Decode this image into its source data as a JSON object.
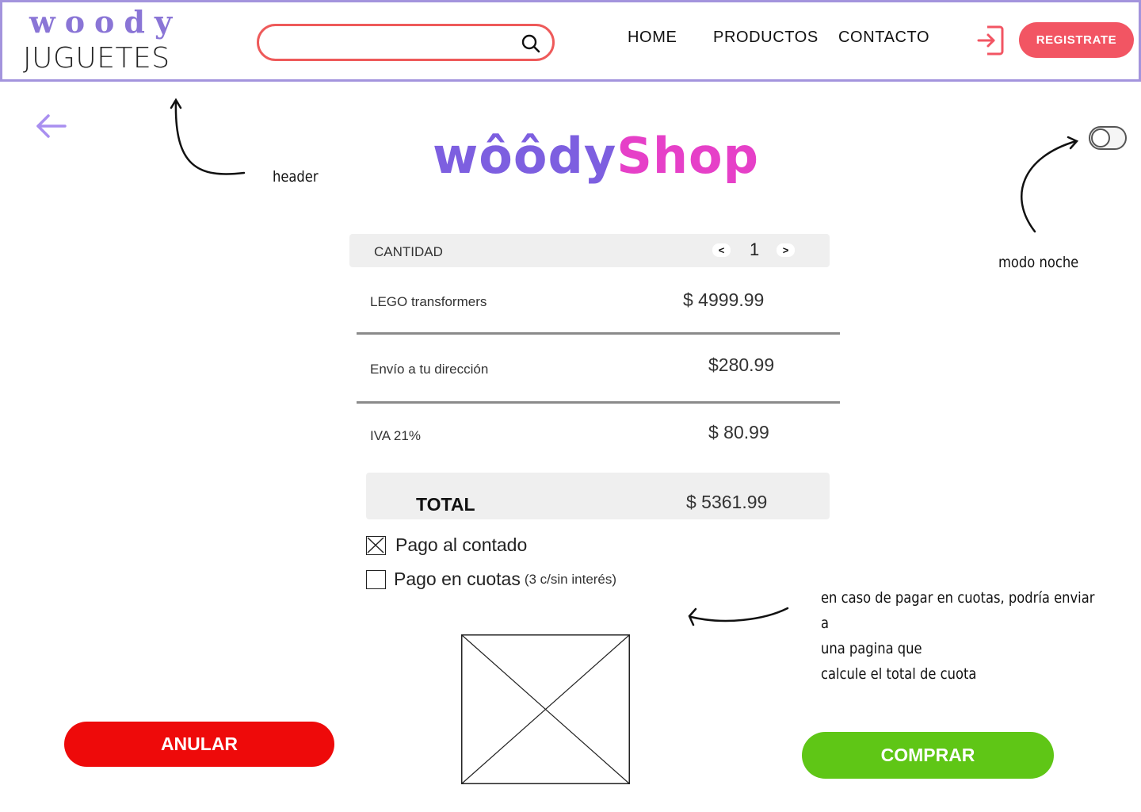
{
  "header": {
    "logo_top": "woody",
    "logo_bottom": "JUGUETES",
    "search": {
      "value": "",
      "icon": "search-icon"
    },
    "nav": [
      "HOME",
      "PRODUCTOS",
      "CONTACTO"
    ],
    "login_icon": "login-icon",
    "register_label": "REGISTRATE"
  },
  "back_icon": "arrow-left-icon",
  "annotations": {
    "header": "header",
    "night_mode": "modo noche",
    "installments": "en caso de pagar en cuotas, podría enviar a\nuna pagina que\ncalcule el total de cuota"
  },
  "shop_logo": {
    "part1": "wôôdy",
    "part2": "Shop"
  },
  "night_mode_toggle": {
    "on": false
  },
  "order": {
    "quantity_label": "CANTIDAD",
    "decrement": "<",
    "quantity": "1",
    "increment": ">",
    "rows": [
      {
        "label": "LEGO transformers",
        "value": "$ 4999.99"
      },
      {
        "label": "Envío a tu dirección",
        "value": "$280.99"
      },
      {
        "label": "IVA 21%",
        "value": "$ 80.99"
      }
    ],
    "total_label": "TOTAL",
    "total_value": "$ 5361.99"
  },
  "payment": {
    "cash_label": "Pago al contado",
    "cash_checked": true,
    "installments_label": "Pago en cuotas",
    "installments_note": "(3 c/sin interés)",
    "installments_checked": false
  },
  "actions": {
    "cancel_label": "ANULAR",
    "buy_label": "COMPRAR"
  },
  "colors": {
    "header_border": "#a394dd",
    "logo_purple": "#8a75d6",
    "search_border": "#ee5a5a",
    "register_bg": "#f25563",
    "cancel_bg": "#ee0a0a",
    "buy_bg": "#5fc616"
  }
}
